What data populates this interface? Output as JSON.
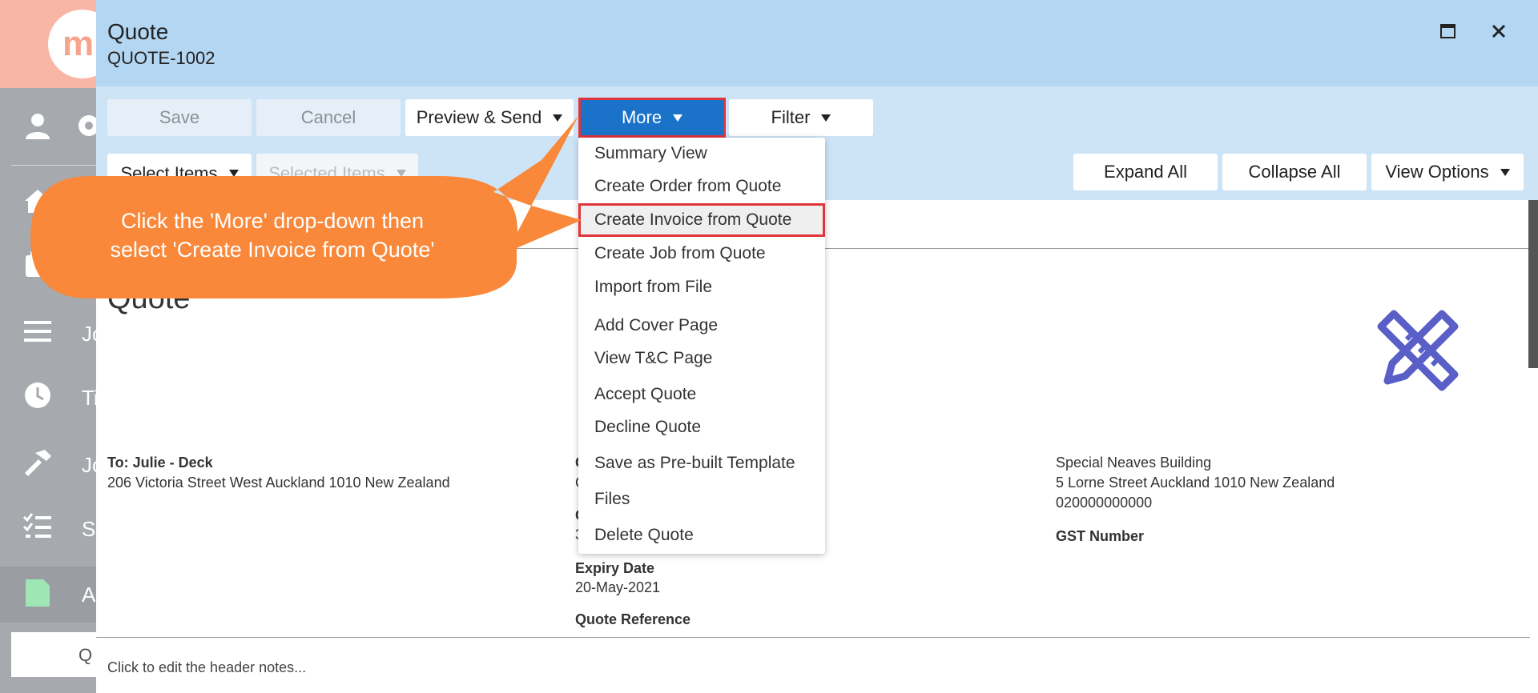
{
  "app": {
    "logo_text": "m"
  },
  "sidebar": {
    "items": [
      {
        "icon": "user-icon",
        "label": ""
      },
      {
        "icon": "gear-icon",
        "label": ""
      },
      {
        "icon": "home-icon",
        "label": ""
      },
      {
        "icon": "calendar-icon",
        "label": ""
      },
      {
        "icon": "menu-icon",
        "label": "Jo"
      },
      {
        "icon": "clock-icon",
        "label": "Ti"
      },
      {
        "icon": "hammer-icon",
        "label": "Jo"
      },
      {
        "icon": "checklist-icon",
        "label": "S"
      },
      {
        "icon": "document-icon",
        "label": "A"
      }
    ],
    "search_text": "Q"
  },
  "modal": {
    "title": "Quote",
    "subtitle": "QUOTE-1002"
  },
  "toolbar": {
    "save": "Save",
    "cancel": "Cancel",
    "preview_send": "Preview & Send",
    "more": "More",
    "filter": "Filter",
    "select_items": "Select Items",
    "selected_items": "Selected Items",
    "expand_all": "Expand All",
    "collapse_all": "Collapse All",
    "view_options": "View Options"
  },
  "more_menu": {
    "items": [
      "Summary View",
      "Create Order from Quote",
      "Create Invoice from Quote",
      "Create Job from Quote",
      "Import from File",
      "Add Cover Page",
      "View T&C Page",
      "Accept Quote",
      "Decline Quote",
      "Save as Pre-built Template",
      "Files",
      "Delete Quote"
    ],
    "highlighted": "Create Invoice from Quote"
  },
  "document": {
    "title": "Quote",
    "to_label": "To: Julie - Deck",
    "to_address": "206 Victoria Street West Auckland 1010 New Zealand",
    "mid_col": {
      "partial_1": "C",
      "partial_2": "C",
      "partial_3": "C",
      "partial_4": "3",
      "expiry_label": "Expiry Date",
      "expiry_value": "20-May-2021",
      "reference_label": "Quote Reference"
    },
    "company": {
      "name": "Special Neaves Building",
      "address": "5 Lorne Street Auckland 1010 New Zealand",
      "phone": "020000000000",
      "gst_label": "GST Number"
    },
    "header_notes": "Click to edit the header notes..."
  },
  "callout": {
    "line1": "Click the 'More' drop-down then",
    "line2": "select 'Create Invoice from Quote'",
    "color": "#f9883a"
  },
  "colors": {
    "header_bg": "#b3d6f2",
    "toolbar_bg": "#cde4f7",
    "primary_button": "#1a73c9",
    "highlight_border": "#e0353a",
    "logo_icon": "#5a5fc8"
  }
}
